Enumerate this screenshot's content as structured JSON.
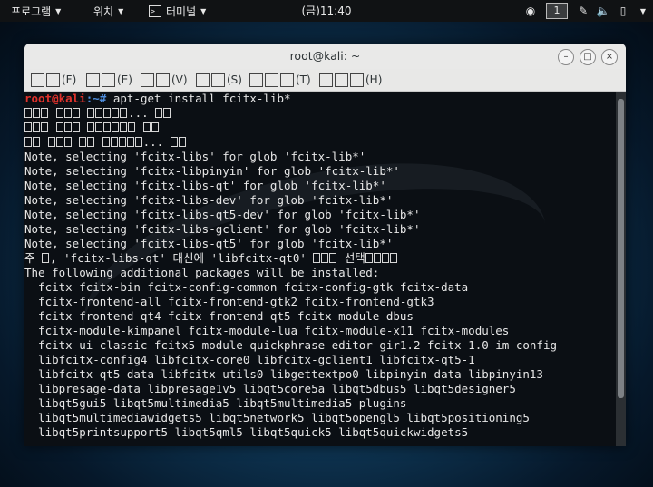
{
  "topbar": {
    "apps_label": "프로그램",
    "places_label": "위치",
    "terminal_label": "터미널",
    "clock": "(금)11:40",
    "workspace": "1",
    "icons": [
      "camera-icon",
      "pen-icon",
      "volume-icon",
      "battery-icon"
    ]
  },
  "window": {
    "title": "root@kali: ~",
    "minimize": "–",
    "maximize": "□",
    "close": "×",
    "menus": [
      {
        "label": "(F)"
      },
      {
        "label": "(E)"
      },
      {
        "label": "(V)"
      },
      {
        "label": "(S)"
      },
      {
        "label": "(T)"
      },
      {
        "label": "(H)"
      }
    ]
  },
  "terminal": {
    "prompt_user": "root@kali",
    "prompt_path": ":~# ",
    "command": "apt-get install fcitx-lib*",
    "status_lines": [
      "...",
      "",
      "...",
      ""
    ],
    "notes": [
      "Note, selecting 'fcitx-libs' for glob 'fcitx-lib*'",
      "Note, selecting 'fcitx-libpinyin' for glob 'fcitx-lib*'",
      "Note, selecting 'fcitx-libs-qt' for glob 'fcitx-lib*'",
      "Note, selecting 'fcitx-libs-dev' for glob 'fcitx-lib*'",
      "Note, selecting 'fcitx-libs-qt5-dev' for glob 'fcitx-lib*'",
      "Note, selecting 'fcitx-libs-gclient' for glob 'fcitx-lib*'",
      "Note, selecting 'fcitx-libs-qt5' for glob 'fcitx-lib*'"
    ],
    "note_ko_pre": "주 ",
    "note_ko_mid": ", 'fcitx-libs-qt' 대신에 'libfcitx-qt0' ",
    "note_ko_sel": " 선택",
    "following": "The following additional packages will be installed:",
    "packages": [
      "  fcitx fcitx-bin fcitx-config-common fcitx-config-gtk fcitx-data",
      "  fcitx-frontend-all fcitx-frontend-gtk2 fcitx-frontend-gtk3",
      "  fcitx-frontend-qt4 fcitx-frontend-qt5 fcitx-module-dbus",
      "  fcitx-module-kimpanel fcitx-module-lua fcitx-module-x11 fcitx-modules",
      "  fcitx-ui-classic fcitx5-module-quickphrase-editor gir1.2-fcitx-1.0 im-config",
      "  libfcitx-config4 libfcitx-core0 libfcitx-gclient1 libfcitx-qt5-1",
      "  libfcitx-qt5-data libfcitx-utils0 libgettextpo0 libpinyin-data libpinyin13",
      "  libpresage-data libpresage1v5 libqt5core5a libqt5dbus5 libqt5designer5",
      "  libqt5gui5 libqt5multimedia5 libqt5multimedia5-plugins",
      "  libqt5multimediawidgets5 libqt5network5 libqt5opengl5 libqt5positioning5",
      "  libqt5printsupport5 libqt5qml5 libqt5quick5 libqt5quickwidgets5"
    ]
  }
}
